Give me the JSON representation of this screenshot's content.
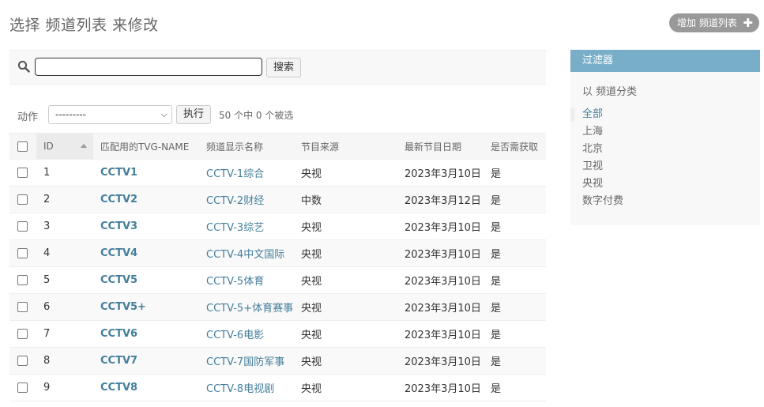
{
  "page": {
    "title": "选择 频道列表 来修改",
    "add_button": "增加 频道列表"
  },
  "search": {
    "value": "",
    "placeholder": "",
    "button_label": "搜索"
  },
  "actions": {
    "label": "动作",
    "selected_option": "---------",
    "run_label": "执行",
    "selection_count": "50 个中 0 个被选"
  },
  "table": {
    "columns": [
      "ID",
      "匹配用的TVG-NAME",
      "频道显示名称",
      "节目来源",
      "最新节目日期",
      "是否需获取"
    ],
    "sorted_column": "ID",
    "rows": [
      {
        "id": "1",
        "tvg": "CCTV1",
        "name": "CCTV-1综合",
        "source": "央视",
        "date": "2023年3月10日",
        "fetch": "是"
      },
      {
        "id": "2",
        "tvg": "CCTV2",
        "name": "CCTV-2财经",
        "source": "中数",
        "date": "2023年3月12日",
        "fetch": "是"
      },
      {
        "id": "3",
        "tvg": "CCTV3",
        "name": "CCTV-3综艺",
        "source": "央视",
        "date": "2023年3月10日",
        "fetch": "是"
      },
      {
        "id": "4",
        "tvg": "CCTV4",
        "name": "CCTV-4中文国际",
        "source": "央视",
        "date": "2023年3月10日",
        "fetch": "是"
      },
      {
        "id": "5",
        "tvg": "CCTV5",
        "name": "CCTV-5体育",
        "source": "央视",
        "date": "2023年3月10日",
        "fetch": "是"
      },
      {
        "id": "6",
        "tvg": "CCTV5+",
        "name": "CCTV-5+体育赛事",
        "source": "央视",
        "date": "2023年3月10日",
        "fetch": "是"
      },
      {
        "id": "7",
        "tvg": "CCTV6",
        "name": "CCTV-6电影",
        "source": "央视",
        "date": "2023年3月10日",
        "fetch": "是"
      },
      {
        "id": "8",
        "tvg": "CCTV7",
        "name": "CCTV-7国防军事",
        "source": "央视",
        "date": "2023年3月10日",
        "fetch": "是"
      },
      {
        "id": "9",
        "tvg": "CCTV8",
        "name": "CCTV-8电视剧",
        "source": "央视",
        "date": "2023年3月10日",
        "fetch": "是"
      }
    ]
  },
  "filter": {
    "header": "过滤器",
    "title": "以 频道分类",
    "items": [
      "全部",
      "上海",
      "北京",
      "卫视",
      "央视",
      "数字付费"
    ],
    "selected": "全部"
  },
  "colors": {
    "filter_header": "#79aec8",
    "link": "#447e9b",
    "add_button": "#999999"
  }
}
